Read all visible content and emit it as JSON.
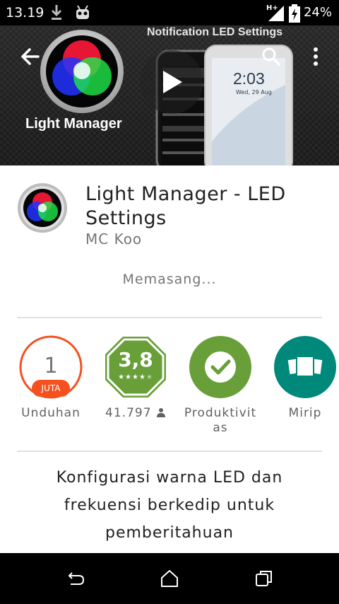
{
  "status_bar": {
    "time": "13.19",
    "signal_label": "H+",
    "battery_percent": "24%"
  },
  "header": {
    "back_icon": "arrow-back-icon",
    "search_icon": "search-icon",
    "menu_icon": "overflow-menu-icon"
  },
  "banner": {
    "caption": "Notification LED Settings",
    "logo_text": "Light Manager",
    "phone_time": "2:03",
    "phone_date": "Wed, 29 Aug",
    "play_icon": "play-icon"
  },
  "app": {
    "title": "Light Manager - LED Settings",
    "developer": "MC Koo",
    "install_status": "Memasang..."
  },
  "stats": {
    "downloads": {
      "number": "1",
      "unit": "JUTA",
      "label": "Unduhan"
    },
    "rating": {
      "value": "3,8",
      "stars": 3.8,
      "count": "41.797"
    },
    "category": {
      "label": "Produktivitas",
      "color": "#689f38"
    },
    "similar": {
      "label": "Mirip",
      "color": "#00897b"
    }
  },
  "description": "Konfigurasi warna LED dan frekuensi berkedip untuk pemberitahuan",
  "colors": {
    "downloads_accent": "#f4511e",
    "rating_green": "#689f38",
    "similar_teal": "#00897b"
  }
}
